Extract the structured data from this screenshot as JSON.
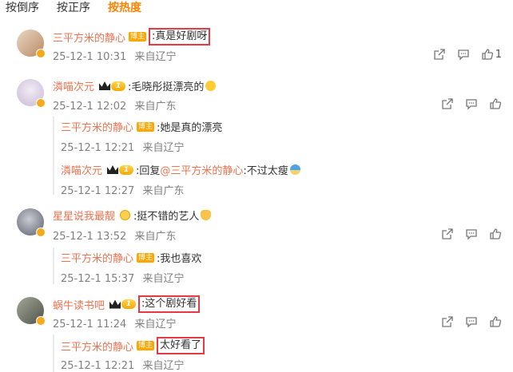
{
  "sort_tabs": [
    {
      "label": "按倒序",
      "active": false
    },
    {
      "label": "按正序",
      "active": false
    },
    {
      "label": "按热度",
      "active": true
    }
  ],
  "comments": [
    {
      "user": "三平方米的静心",
      "host_tag": "博主",
      "text": ":真是好剧呀",
      "date": "25-12-1 10:31",
      "location": "来自辽宁",
      "like_count": "1",
      "replies": []
    },
    {
      "user": "潾喵次元",
      "vip_level": "1",
      "text": ":毛晓彤挺漂亮的",
      "date": "25-12-1 12:02",
      "location": "来自广东",
      "like_count": "",
      "replies": [
        {
          "user": "三平方米的静心",
          "host_tag": "博主",
          "text": ":她是真的漂亮",
          "date": "25-12-1 12:21",
          "location": "来自辽宁"
        },
        {
          "user": "潾喵次元",
          "vip_level": "1",
          "text_prefix": ":回复",
          "mention": "@三平方米的静心",
          "text": ":不过太瘦",
          "date": "25-12-1 12:27",
          "location": "来自广东"
        }
      ]
    },
    {
      "user": "星星说我最靓",
      "text": ":挺不错的艺人",
      "date": "25-12-1 13:52",
      "location": "来自广东",
      "like_count": "",
      "replies": [
        {
          "user": "三平方米的静心",
          "host_tag": "博主",
          "text": ":我也喜欢",
          "date": "25-12-1 15:37",
          "location": "来自辽宁"
        }
      ]
    },
    {
      "user": "蜗牛读书吧",
      "vip_level": "1",
      "text": ":这个剧好看",
      "date": "25-12-1 11:24",
      "location": "来自辽宁",
      "like_count": "",
      "replies": [
        {
          "user": "三平方米的静心",
          "host_tag": "博主",
          "text": "太好看了",
          "date": "25-12-1 12:21",
          "location": "来自辽宁"
        }
      ]
    }
  ],
  "icons": {
    "share": "share-icon",
    "comment": "comment-icon",
    "like": "like-icon"
  },
  "colors": {
    "accent": "#ff8200",
    "username": "#eb7350",
    "highlight_box": "#e63946",
    "meta": "#808080"
  }
}
